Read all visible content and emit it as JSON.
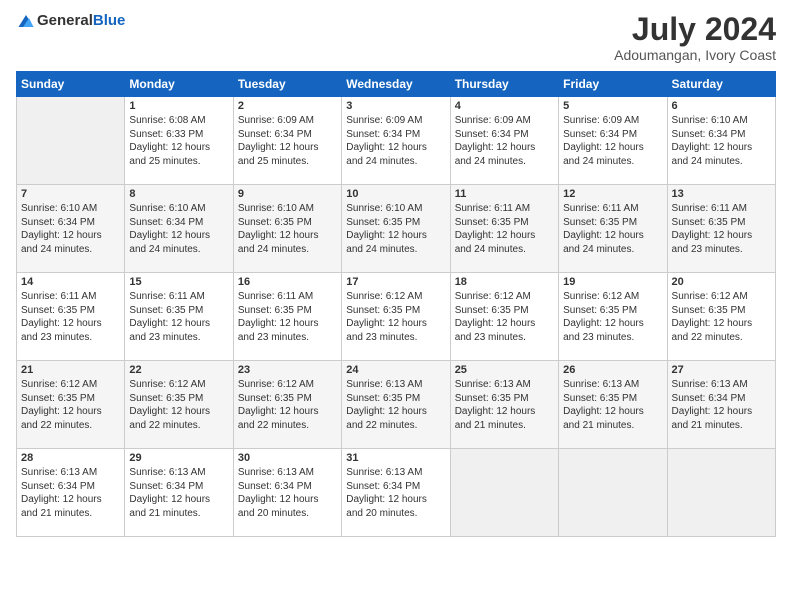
{
  "logo": {
    "text_general": "General",
    "text_blue": "Blue"
  },
  "header": {
    "title": "July 2024",
    "subtitle": "Adoumangan, Ivory Coast"
  },
  "calendar": {
    "days_of_week": [
      "Sunday",
      "Monday",
      "Tuesday",
      "Wednesday",
      "Thursday",
      "Friday",
      "Saturday"
    ],
    "weeks": [
      [
        {
          "day": "",
          "info": ""
        },
        {
          "day": "1",
          "info": "Sunrise: 6:08 AM\nSunset: 6:33 PM\nDaylight: 12 hours\nand 25 minutes."
        },
        {
          "day": "2",
          "info": "Sunrise: 6:09 AM\nSunset: 6:34 PM\nDaylight: 12 hours\nand 25 minutes."
        },
        {
          "day": "3",
          "info": "Sunrise: 6:09 AM\nSunset: 6:34 PM\nDaylight: 12 hours\nand 24 minutes."
        },
        {
          "day": "4",
          "info": "Sunrise: 6:09 AM\nSunset: 6:34 PM\nDaylight: 12 hours\nand 24 minutes."
        },
        {
          "day": "5",
          "info": "Sunrise: 6:09 AM\nSunset: 6:34 PM\nDaylight: 12 hours\nand 24 minutes."
        },
        {
          "day": "6",
          "info": "Sunrise: 6:10 AM\nSunset: 6:34 PM\nDaylight: 12 hours\nand 24 minutes."
        }
      ],
      [
        {
          "day": "7",
          "info": "Sunrise: 6:10 AM\nSunset: 6:34 PM\nDaylight: 12 hours\nand 24 minutes."
        },
        {
          "day": "8",
          "info": "Sunrise: 6:10 AM\nSunset: 6:34 PM\nDaylight: 12 hours\nand 24 minutes."
        },
        {
          "day": "9",
          "info": "Sunrise: 6:10 AM\nSunset: 6:35 PM\nDaylight: 12 hours\nand 24 minutes."
        },
        {
          "day": "10",
          "info": "Sunrise: 6:10 AM\nSunset: 6:35 PM\nDaylight: 12 hours\nand 24 minutes."
        },
        {
          "day": "11",
          "info": "Sunrise: 6:11 AM\nSunset: 6:35 PM\nDaylight: 12 hours\nand 24 minutes."
        },
        {
          "day": "12",
          "info": "Sunrise: 6:11 AM\nSunset: 6:35 PM\nDaylight: 12 hours\nand 24 minutes."
        },
        {
          "day": "13",
          "info": "Sunrise: 6:11 AM\nSunset: 6:35 PM\nDaylight: 12 hours\nand 23 minutes."
        }
      ],
      [
        {
          "day": "14",
          "info": "Sunrise: 6:11 AM\nSunset: 6:35 PM\nDaylight: 12 hours\nand 23 minutes."
        },
        {
          "day": "15",
          "info": "Sunrise: 6:11 AM\nSunset: 6:35 PM\nDaylight: 12 hours\nand 23 minutes."
        },
        {
          "day": "16",
          "info": "Sunrise: 6:11 AM\nSunset: 6:35 PM\nDaylight: 12 hours\nand 23 minutes."
        },
        {
          "day": "17",
          "info": "Sunrise: 6:12 AM\nSunset: 6:35 PM\nDaylight: 12 hours\nand 23 minutes."
        },
        {
          "day": "18",
          "info": "Sunrise: 6:12 AM\nSunset: 6:35 PM\nDaylight: 12 hours\nand 23 minutes."
        },
        {
          "day": "19",
          "info": "Sunrise: 6:12 AM\nSunset: 6:35 PM\nDaylight: 12 hours\nand 23 minutes."
        },
        {
          "day": "20",
          "info": "Sunrise: 6:12 AM\nSunset: 6:35 PM\nDaylight: 12 hours\nand 22 minutes."
        }
      ],
      [
        {
          "day": "21",
          "info": "Sunrise: 6:12 AM\nSunset: 6:35 PM\nDaylight: 12 hours\nand 22 minutes."
        },
        {
          "day": "22",
          "info": "Sunrise: 6:12 AM\nSunset: 6:35 PM\nDaylight: 12 hours\nand 22 minutes."
        },
        {
          "day": "23",
          "info": "Sunrise: 6:12 AM\nSunset: 6:35 PM\nDaylight: 12 hours\nand 22 minutes."
        },
        {
          "day": "24",
          "info": "Sunrise: 6:13 AM\nSunset: 6:35 PM\nDaylight: 12 hours\nand 22 minutes."
        },
        {
          "day": "25",
          "info": "Sunrise: 6:13 AM\nSunset: 6:35 PM\nDaylight: 12 hours\nand 21 minutes."
        },
        {
          "day": "26",
          "info": "Sunrise: 6:13 AM\nSunset: 6:35 PM\nDaylight: 12 hours\nand 21 minutes."
        },
        {
          "day": "27",
          "info": "Sunrise: 6:13 AM\nSunset: 6:34 PM\nDaylight: 12 hours\nand 21 minutes."
        }
      ],
      [
        {
          "day": "28",
          "info": "Sunrise: 6:13 AM\nSunset: 6:34 PM\nDaylight: 12 hours\nand 21 minutes."
        },
        {
          "day": "29",
          "info": "Sunrise: 6:13 AM\nSunset: 6:34 PM\nDaylight: 12 hours\nand 21 minutes."
        },
        {
          "day": "30",
          "info": "Sunrise: 6:13 AM\nSunset: 6:34 PM\nDaylight: 12 hours\nand 20 minutes."
        },
        {
          "day": "31",
          "info": "Sunrise: 6:13 AM\nSunset: 6:34 PM\nDaylight: 12 hours\nand 20 minutes."
        },
        {
          "day": "",
          "info": ""
        },
        {
          "day": "",
          "info": ""
        },
        {
          "day": "",
          "info": ""
        }
      ]
    ]
  }
}
